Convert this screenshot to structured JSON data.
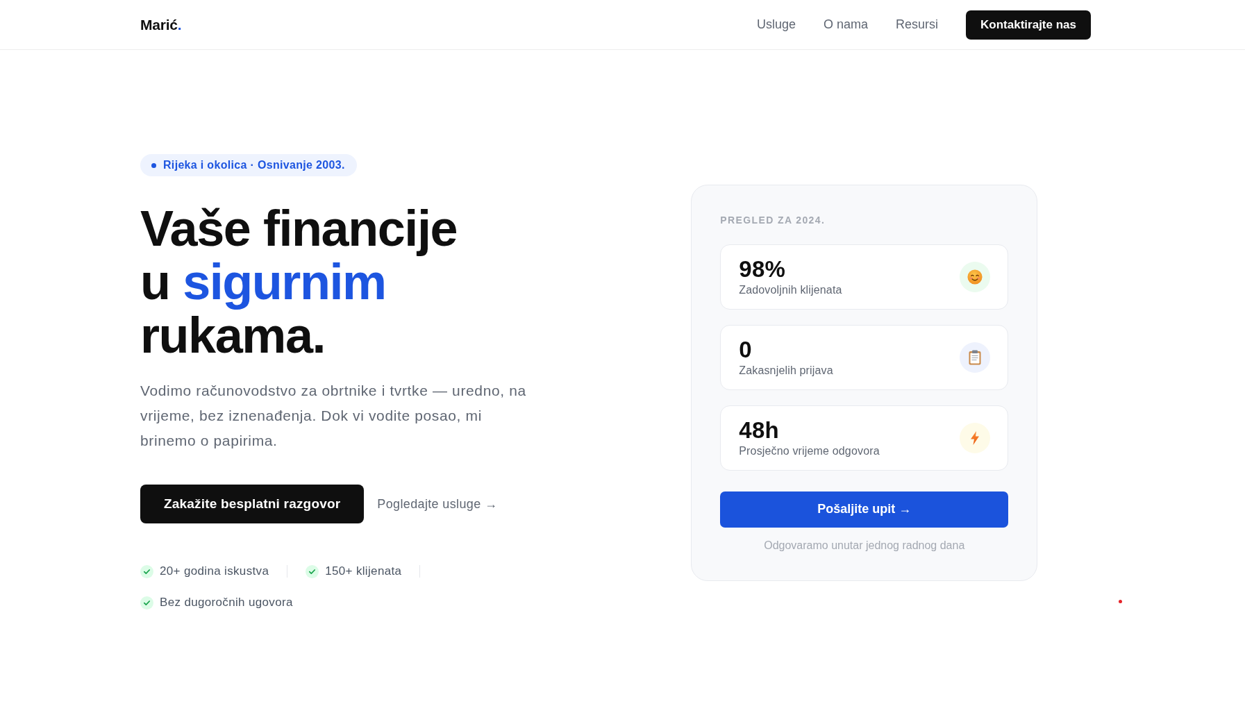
{
  "header": {
    "logo": {
      "name": "Marić",
      "accent": "."
    },
    "nav": [
      "Usluge",
      "O nama",
      "Resursi"
    ],
    "cta": "Kontaktirajte nas"
  },
  "hero": {
    "badge": "Rijeka i okolica · Osnivanje 2003.",
    "headline": [
      {
        "segments": [
          {
            "text": "Vaše financije",
            "highlight": false
          }
        ]
      },
      {
        "segments": [
          {
            "text": "u",
            "highlight": false
          },
          {
            "text": "sigurnim",
            "highlight": true
          }
        ]
      },
      {
        "segments": [
          {
            "text": "rukama.",
            "highlight": false
          }
        ]
      }
    ],
    "description": "Vodimo računovodstvo za obrtnike i tvrtke — uredno, na vrijeme, bez iznenađenja. Dok vi vodite posao, mi brinemo o papirima.",
    "primary_button": "Zakažite besplatni razgovor",
    "secondary_link": "Pogledajte usluge →",
    "highlights": [
      "20+ godina iskustva",
      "150+ klijenata",
      "Bez dugoročnih ugovora"
    ]
  },
  "summary_card": {
    "title": "PREGLED ZA 2024.",
    "stats": [
      {
        "value": "98%",
        "label": "Zadovoljnih klijenata",
        "color": "#ebfbef"
      },
      {
        "value": "0",
        "label": "Zakasnjelih prijava",
        "color": "#eef2fd"
      },
      {
        "value": "48h",
        "label": "Prosječno vrijeme odgovora",
        "color": "#fefbe8"
      }
    ],
    "button": "Pošaljite upit →",
    "note": "Odgovaramo unutar jednog radnog dana"
  }
}
